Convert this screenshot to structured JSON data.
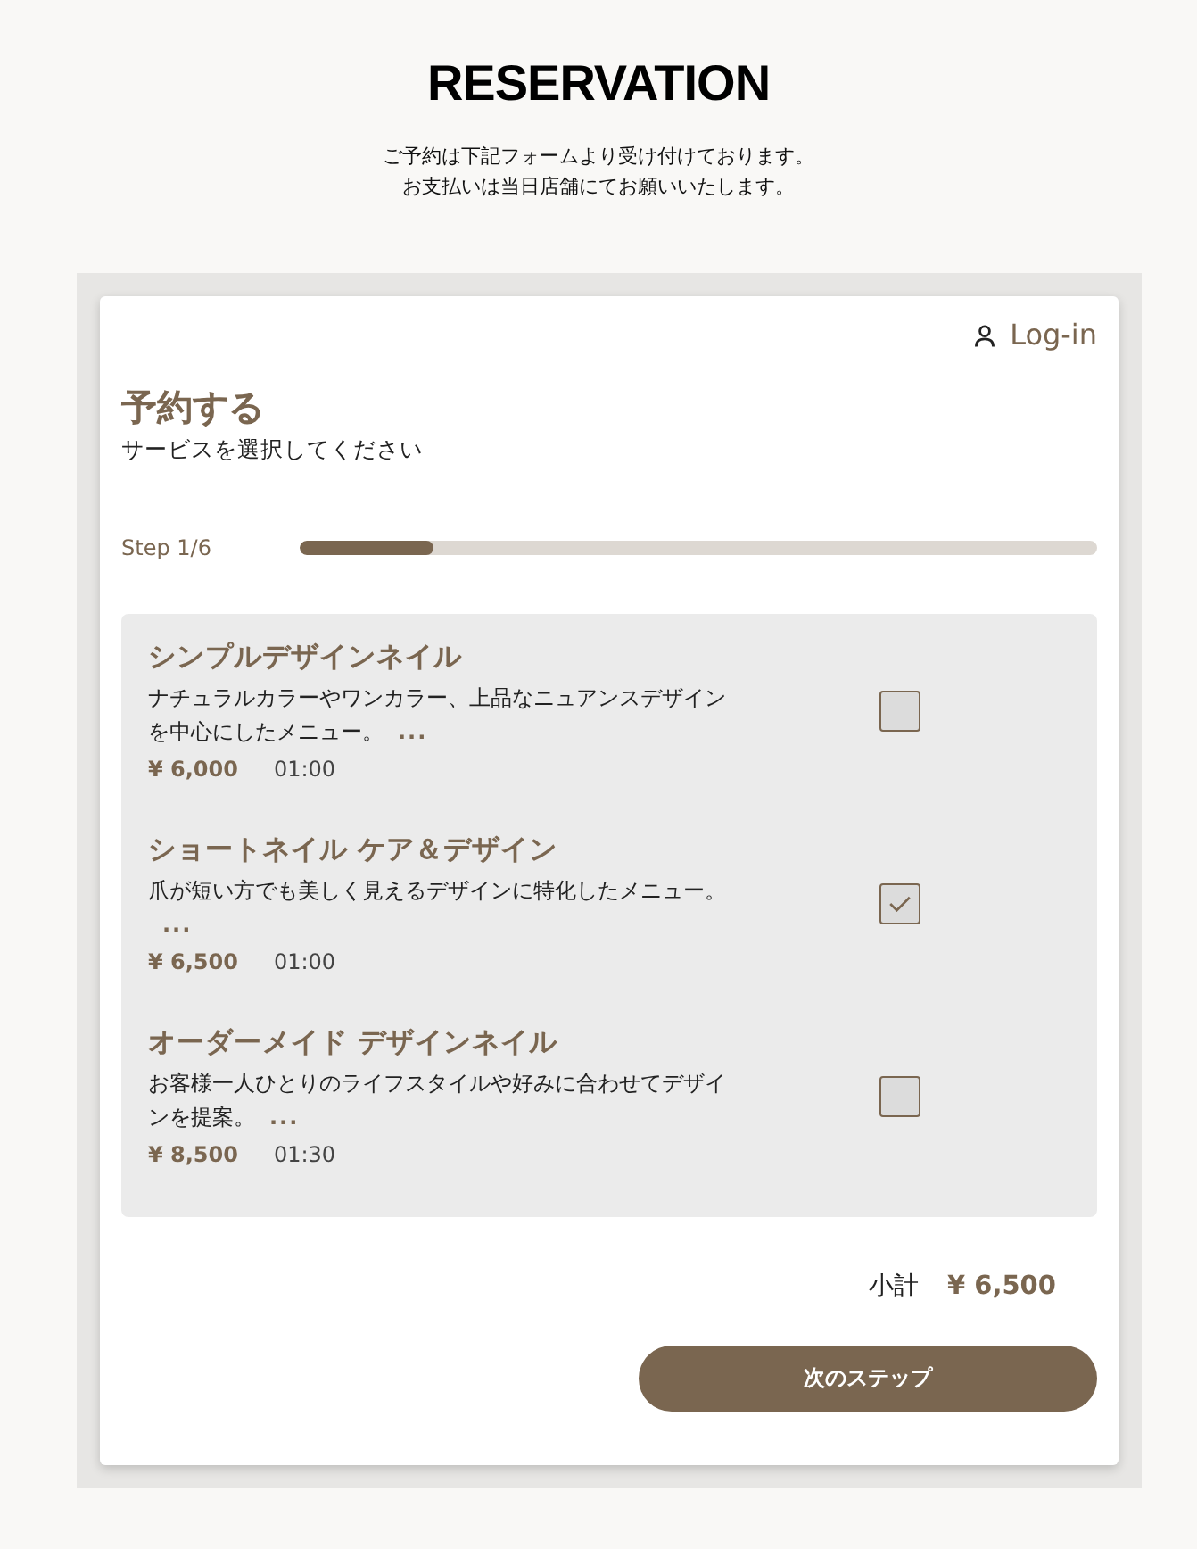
{
  "header": {
    "title": "RESERVATION",
    "notice": [
      "ご予約は下記フォームより受け付けております。",
      "お支払いは当日店舗にてお願いいたします。"
    ]
  },
  "card": {
    "login": "Log-in",
    "heading": "予約する",
    "subheading": "サービスを選択してください",
    "step": {
      "label": "Step 1/6",
      "level": 0.167
    },
    "services": [
      {
        "name": "シンプルデザインネイル",
        "description": "ナチュラルカラーやワンカラー、上品なニュアンスデザインを中心にしたメニュー。",
        "more": "...",
        "price": "¥ 6,000",
        "duration": "01:00",
        "checked": false
      },
      {
        "name": "ショートネイル ケア＆デザイン",
        "description": "爪が短い方でも美しく見えるデザインに特化したメニュー。",
        "more": "...",
        "price": "¥ 6,500",
        "duration": "01:00",
        "checked": true
      },
      {
        "name": "オーダーメイド デザインネイル",
        "description": "お客様一人ひとりのライフスタイルや好みに合わせてデザインを提案。",
        "more": "...",
        "price": "¥ 8,500",
        "duration": "01:30",
        "checked": false
      }
    ],
    "subtotal": {
      "label": "小計",
      "amount": "¥ 6,500"
    },
    "next_button": "次のステップ"
  }
}
